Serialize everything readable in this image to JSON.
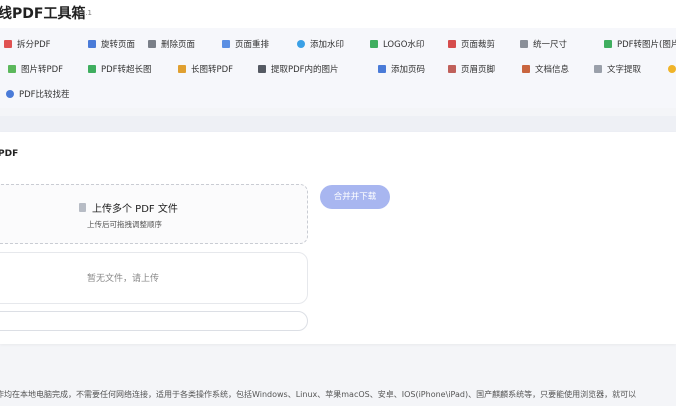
{
  "header": {
    "title": "线PDF工具箱",
    "version": "V3.1"
  },
  "toolbar": {
    "row1": [
      {
        "label": "拆分PDF",
        "icon": "scissors-icon",
        "color": "#e05252"
      },
      {
        "label": "旋转页面",
        "icon": "rotate-icon",
        "color": "#4a7bd8"
      },
      {
        "label": "删除页面",
        "icon": "trash-icon",
        "color": "#7a7f88"
      },
      {
        "label": "页面重排",
        "icon": "pages-icon",
        "color": "#5b8fe3"
      },
      {
        "label": "添加水印",
        "icon": "drop-icon",
        "color": "#3aa0e6"
      },
      {
        "label": "LOGO水印",
        "icon": "image-icon",
        "color": "#3fae5f"
      },
      {
        "label": "页面裁剪",
        "icon": "crop-icon",
        "color": "#d64d4d"
      },
      {
        "label": "统一尺寸",
        "icon": "ruler-icon",
        "color": "#8a8f98"
      },
      {
        "label": "PDF转图片(图片",
        "icon": "picture-icon",
        "color": "#3fae5f"
      }
    ],
    "row2": [
      {
        "label": "图片转PDF",
        "icon": "leaf-icon",
        "color": "#5cb85c"
      },
      {
        "label": "PDF转超长图",
        "icon": "image-icon",
        "color": "#3fae5f"
      },
      {
        "label": "长图转PDF",
        "icon": "scroll-icon",
        "color": "#e0a030"
      },
      {
        "label": "提取PDF内的图片",
        "icon": "camera-icon",
        "color": "#555a63"
      },
      {
        "label": "添加页码",
        "icon": "number-icon",
        "color": "#4a7bd8"
      },
      {
        "label": "页眉页脚",
        "icon": "header-footer-icon",
        "color": "#c0605a"
      },
      {
        "label": "文档信息",
        "icon": "info-icon",
        "color": "#c9653f"
      },
      {
        "label": "文字提取",
        "icon": "text-icon",
        "color": "#9aa0aa"
      },
      {
        "label": "",
        "icon": "bulb-icon",
        "color": "#f0b429"
      }
    ],
    "row3": [
      {
        "label": "PDF比较找茬",
        "icon": "magnifier-icon",
        "color": "#4a7bd8"
      }
    ]
  },
  "main": {
    "title": "PDF",
    "upload_label": "上传多个 PDF 文件",
    "upload_hint": "上传后可拖拽调整顺序",
    "merge_button": "合并并下载",
    "empty_message": "暂无文件，请上传"
  },
  "footer": {
    "note": "作均在本地电脑完成，不需要任何网络连接，适用于各类操作系统，包括Windows、Linux、苹果macOS、安卓、IOS(iPhone\\iPad)、国产麒麟系统等，只要能使用浏览器，就可以"
  }
}
